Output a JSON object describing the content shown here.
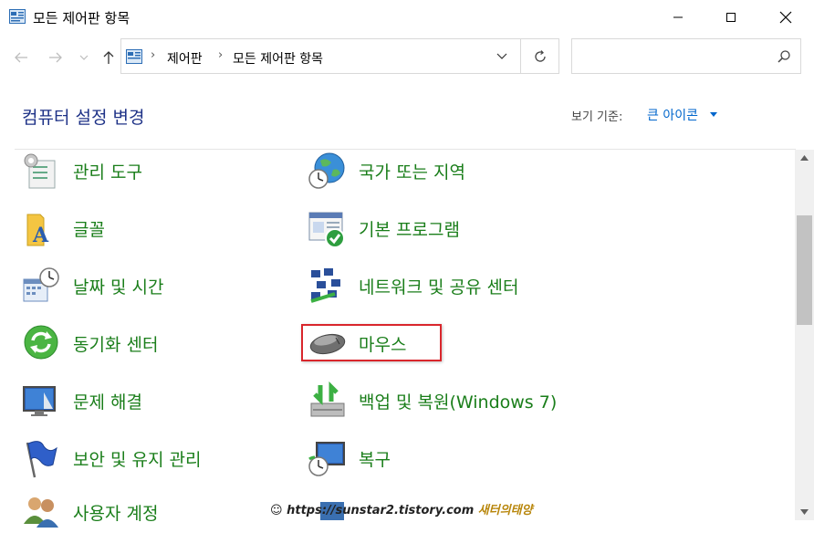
{
  "window": {
    "title": "모든 제어판 항목"
  },
  "address": {
    "crumbs": [
      "제어판",
      "모든 제어판 항목"
    ],
    "search_placeholder": ""
  },
  "header": {
    "heading": "컴퓨터 설정 변경",
    "view_by_label": "보기 기준:",
    "view_by_value": "큰 아이콘"
  },
  "items": {
    "col1": [
      {
        "label": "관리 도구",
        "icon": "admin-tools-icon"
      },
      {
        "label": "글꼴",
        "icon": "fonts-icon"
      },
      {
        "label": "날짜 및 시간",
        "icon": "date-time-icon"
      },
      {
        "label": "동기화 센터",
        "icon": "sync-center-icon"
      },
      {
        "label": "문제 해결",
        "icon": "troubleshooting-icon"
      },
      {
        "label": "보안 및 유지 관리",
        "icon": "security-flag-icon"
      },
      {
        "label": "사용자 계정",
        "icon": "user-accounts-icon"
      }
    ],
    "col2": [
      {
        "label": "국가 또는 지역",
        "icon": "region-globe-icon"
      },
      {
        "label": "기본 프로그램",
        "icon": "default-programs-icon"
      },
      {
        "label": "네트워크 및 공유 센터",
        "icon": "network-icon"
      },
      {
        "label": "마우스",
        "icon": "mouse-icon"
      },
      {
        "label": "백업 및 복원(Windows 7)",
        "icon": "backup-icon"
      },
      {
        "label": "복구",
        "icon": "recovery-icon"
      }
    ]
  },
  "watermark": {
    "url": "https://sunstar2.tistory.com",
    "name": "새터의태양"
  },
  "colors": {
    "link_green": "#1a7e1a",
    "heading_blue": "#1e3287",
    "highlight_red": "#d9262c"
  }
}
